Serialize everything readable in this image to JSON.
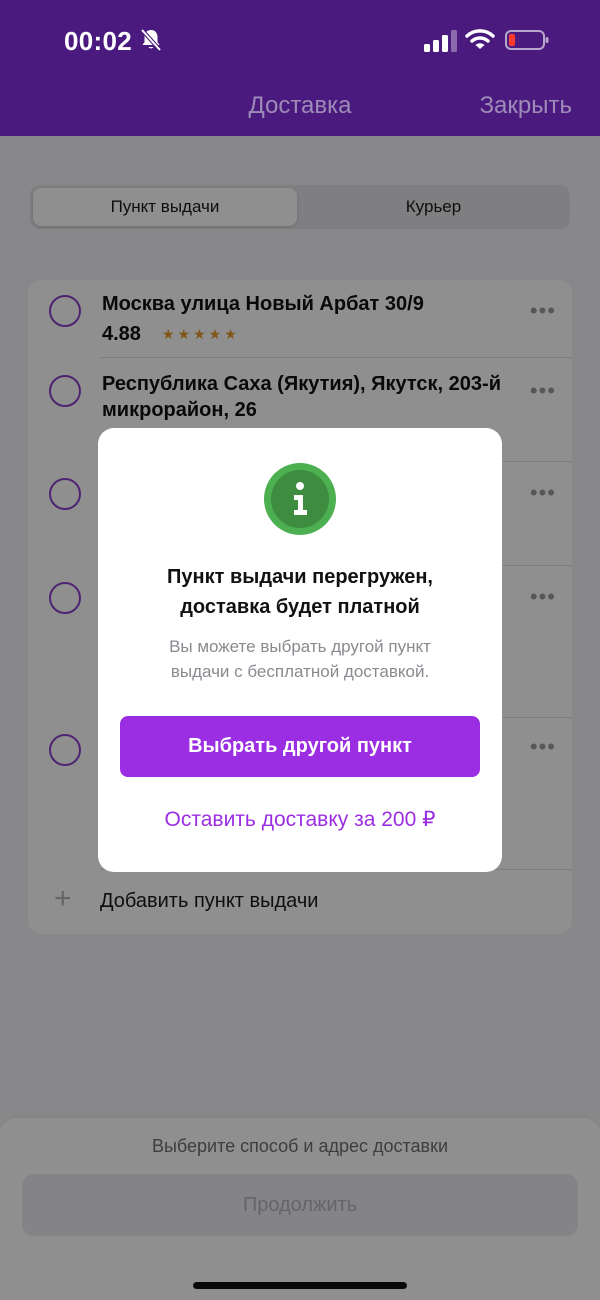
{
  "status_bar": {
    "time": "00:02",
    "icons": [
      "bell-slash-icon",
      "cellular-signal-icon",
      "wifi-icon",
      "battery-low-icon"
    ]
  },
  "nav": {
    "title": "Доставка",
    "close_label": "Закрыть"
  },
  "delivery_type": {
    "options": [
      {
        "label": "Пункт выдачи",
        "selected": true
      },
      {
        "label": "Курьер",
        "selected": false
      }
    ]
  },
  "pickup_points": {
    "items": [
      {
        "title": "Москва  улица Новый Арбат 30/9",
        "rating": "4.88",
        "stars": "★★★★★"
      },
      {
        "title": "Республика Саха (Якутия), Якутск, 203-й микрорайон, 26"
      },
      {
        "title": ""
      },
      {
        "title": ""
      },
      {
        "title": ""
      }
    ],
    "more_label": "•••",
    "add_label": "Добавить пункт выдачи"
  },
  "bottom": {
    "hint": "Выберите способ и адрес доставки",
    "continue_label": "Продолжить"
  },
  "modal": {
    "title_line1": "Пункт выдачи перегружен,",
    "title_line2": "доставка будет платной",
    "text_line1": "Вы можете выбрать другой пункт",
    "text_line2": "выдачи с бесплатной доставкой.",
    "primary_label": "Выбрать другой пункт",
    "secondary_label": "Оставить доставку за 200 ₽",
    "icon": "info-icon"
  },
  "colors": {
    "header_bg": "#4a1a7e",
    "accent": "#9b2ee2",
    "radio": "#8b3fc9",
    "info_green": "#4caf50",
    "star": "#e39a2b"
  }
}
